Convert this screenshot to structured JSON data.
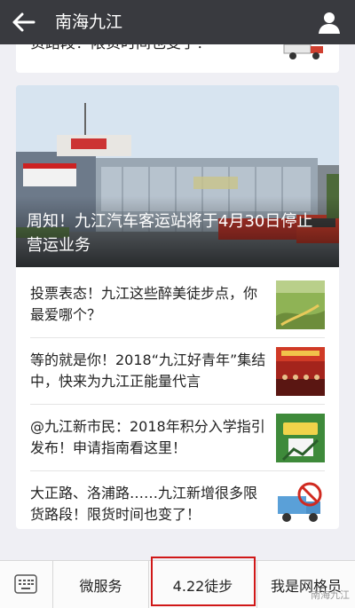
{
  "header": {
    "title": "南海九江",
    "back_icon": "arrow-left-icon",
    "profile_icon": "person-icon"
  },
  "articles": {
    "previous_fragment": "货路段！限货时间也变了！",
    "featured": {
      "caption": "周知！九江汽车客运站将于4月30日停止营运业务"
    },
    "items": [
      {
        "title": "投票表态！九江这些醉美徒步点，你最爱哪个？"
      },
      {
        "title": "等的就是你！2018“九江好青年”集结中，快来为九江正能量代言"
      },
      {
        "title": "@九江新市民：2018年积分入学指引发布！申请指南看这里！"
      },
      {
        "title": "大正路、洛浦路……九江新增很多限货路段！限货时间也变了！"
      }
    ]
  },
  "bottom_menu": {
    "keyboard_icon": "keyboard-icon",
    "items": [
      {
        "label": "微服务"
      },
      {
        "label": "4.22徒步"
      },
      {
        "label": "我是网格员"
      }
    ],
    "highlight_color": "#d01818"
  },
  "watermark": "南海九江"
}
